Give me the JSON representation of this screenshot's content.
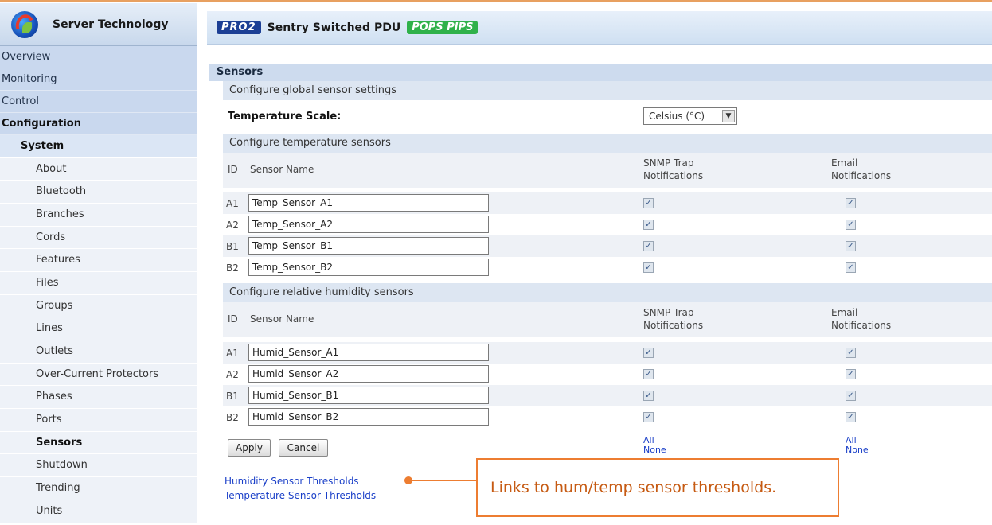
{
  "brand": {
    "name": "Server Technology"
  },
  "header": {
    "pro_badge": "PRO2",
    "title": "Sentry Switched PDU",
    "pops_badge": "POPS PIPS"
  },
  "sidebar": {
    "top": [
      {
        "label": "Overview"
      },
      {
        "label": "Monitoring"
      },
      {
        "label": "Control"
      },
      {
        "label": "Configuration"
      }
    ],
    "section": "System",
    "items": [
      {
        "label": "About"
      },
      {
        "label": "Bluetooth"
      },
      {
        "label": "Branches"
      },
      {
        "label": "Cords"
      },
      {
        "label": "Features"
      },
      {
        "label": "Files"
      },
      {
        "label": "Groups"
      },
      {
        "label": "Lines"
      },
      {
        "label": "Outlets"
      },
      {
        "label": "Over-Current Protectors"
      },
      {
        "label": "Phases"
      },
      {
        "label": "Ports"
      },
      {
        "label": "Sensors"
      },
      {
        "label": "Shutdown"
      },
      {
        "label": "Trending"
      },
      {
        "label": "Units"
      }
    ]
  },
  "main": {
    "section_title": "Sensors",
    "global": {
      "title": "Configure global sensor settings",
      "scale_label": "Temperature Scale:",
      "scale_value": "Celsius (°C)"
    },
    "columns": {
      "id": "ID",
      "name": "Sensor Name",
      "snmp_1": "SNMP Trap",
      "snmp_2": "Notifications",
      "email_1": "Email",
      "email_2": "Notifications"
    },
    "temp": {
      "title": "Configure temperature sensors",
      "rows": [
        {
          "id": "A1",
          "name": "Temp_Sensor_A1",
          "snmp": true,
          "email": true
        },
        {
          "id": "A2",
          "name": "Temp_Sensor_A2",
          "snmp": true,
          "email": true
        },
        {
          "id": "B1",
          "name": "Temp_Sensor_B1",
          "snmp": true,
          "email": true
        },
        {
          "id": "B2",
          "name": "Temp_Sensor_B2",
          "snmp": true,
          "email": true
        }
      ]
    },
    "humid": {
      "title": "Configure relative humidity sensors",
      "rows": [
        {
          "id": "A1",
          "name": "Humid_Sensor_A1",
          "snmp": true,
          "email": true
        },
        {
          "id": "A2",
          "name": "Humid_Sensor_A2",
          "snmp": true,
          "email": true
        },
        {
          "id": "B1",
          "name": "Humid_Sensor_B1",
          "snmp": true,
          "email": true
        },
        {
          "id": "B2",
          "name": "Humid_Sensor_B2",
          "snmp": true,
          "email": true
        }
      ]
    },
    "buttons": {
      "apply": "Apply",
      "cancel": "Cancel"
    },
    "select_links": {
      "all": "All",
      "none": "None"
    },
    "links": {
      "humidity": "Humidity Sensor Thresholds",
      "temperature": "Temperature Sensor Thresholds"
    }
  },
  "callout": {
    "text": "Links to hum/temp sensor thresholds.",
    "color": "#ed7d31"
  }
}
